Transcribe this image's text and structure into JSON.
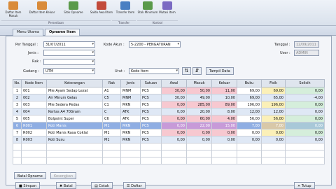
{
  "ribbon": {
    "buttons": [
      {
        "label": "Daftar Item Masuk",
        "color": "#d98b3a",
        "icon": "list-in-icon"
      },
      {
        "label": "Daftar Item Keluar",
        "color": "#d98b3a",
        "icon": "list-out-icon"
      },
      {
        "label": "Stok Opname",
        "color": "#5a9a4a",
        "icon": "stock-opname-icon"
      },
      {
        "label": "Saldo Awal Item",
        "color": "#c24a3a",
        "icon": "initial-balance-icon"
      },
      {
        "label": "Transfer Item",
        "color": "#4a7fc2",
        "icon": "transfer-icon"
      },
      {
        "label": "Stok Minimum",
        "color": "#5a9a4a",
        "icon": "min-stock-icon"
      },
      {
        "label": "Mutasi Item",
        "color": "#7a6ac2",
        "icon": "mutation-icon"
      }
    ],
    "groups": [
      "Persediaan",
      "Transfer",
      "Kontrol"
    ]
  },
  "tabs": [
    "Menu Utama",
    "Opname Item"
  ],
  "form": {
    "tanggal_label": "Per Tanggal :",
    "tanggal_value": "31/07/2011",
    "jenis_label": "Jenis :",
    "rak_label": "Rak :",
    "gudang_label": "Gudang :",
    "gudang_value": "UTM",
    "akun_label": "Kode Akun :",
    "akun_value": "5-2200 - PENGATURAN",
    "urut_label": "Urut :",
    "urut_value": "Kode Item",
    "tampil_label": "Tampil Data",
    "tanggal2_label": "Tanggal :",
    "tanggal2_value": "12/09/2011",
    "user_label": "User :",
    "user_value": "ADMIN"
  },
  "grid": {
    "headers": [
      "No.",
      "Kode Item",
      "Keterangan",
      "Rak",
      "Jenis",
      "Satuan",
      "Awal",
      "Masuk",
      "Keluar",
      "Buku",
      "Fisik",
      "Selisih"
    ],
    "rows": [
      {
        "no": "1",
        "kode": "001",
        "ket": "Mie Ayam Sedap Lezat",
        "rak": "A1",
        "jenis": "MNM",
        "satuan": "PCS",
        "awal": "30,00",
        "masuk": "50,00",
        "keluar": "11,00",
        "buku": "69,00",
        "fisik": "69,00",
        "selisih": "0,00"
      },
      {
        "no": "2",
        "kode": "002",
        "ket": "Air Minum Gelas",
        "rak": "C5",
        "jenis": "MNM",
        "satuan": "PCS",
        "awal": "30,00",
        "masuk": "49,00",
        "keluar": "10,00",
        "buku": "69,00",
        "fisik": "65,00",
        "selisih": "-4,00"
      },
      {
        "no": "3",
        "kode": "003",
        "ket": "Mie Sedera Pedas",
        "rak": "C1",
        "jenis": "MKN",
        "satuan": "PCS",
        "awal": "0,00",
        "masuk": "285,00",
        "keluar": "89,00",
        "buku": "196,00",
        "fisik": "196,00",
        "selisih": "0,00"
      },
      {
        "no": "4",
        "kode": "004",
        "ket": "Kertas A4 70Gram",
        "rak": "C",
        "jenis": "ATK",
        "satuan": "PCS",
        "awal": "0,00",
        "masuk": "20,00",
        "keluar": "8,00",
        "buku": "12,00",
        "fisik": "12,00",
        "selisih": "0,00"
      },
      {
        "no": "5",
        "kode": "005",
        "ket": "Bolpoint Super",
        "rak": "C6",
        "jenis": "ATK",
        "satuan": "PCS",
        "awal": "0,00",
        "masuk": "60,00",
        "keluar": "4,00",
        "buku": "56,00",
        "fisik": "56,00",
        "selisih": "0,00"
      },
      {
        "no": "6",
        "kode": "R001",
        "ket": "Roti Manis",
        "rak": "M1",
        "jenis": "MKN",
        "satuan": "PCS",
        "awal": "0,00",
        "masuk": "22,00",
        "keluar": "15,00",
        "buku": "7,00",
        "fisik": "7,00",
        "selisih": "0,00"
      },
      {
        "no": "7",
        "kode": "R002",
        "ket": "Roti Manis Rasa Coklat",
        "rak": "M1",
        "jenis": "MKN",
        "satuan": "PCS",
        "awal": "0,00",
        "masuk": "0,00",
        "keluar": "0,00",
        "buku": "0,00",
        "fisik": "0,00",
        "selisih": "0,00"
      },
      {
        "no": "8",
        "kode": "R003",
        "ket": "Roti Susu",
        "rak": "M1",
        "jenis": "MKN",
        "satuan": "PCS",
        "awal": "0,00",
        "masuk": "0,00",
        "keluar": "0,00",
        "buku": "0,00",
        "fisik": "0,00",
        "selisih": "0,00"
      }
    ]
  },
  "buttons": {
    "batal_opname": "Batal Opname",
    "koreksi": "Kosongkan",
    "simpan": "Simpan",
    "batal": "Batal",
    "cetak": "Cetak",
    "daftar": "Daftar",
    "tutup": "Tutup"
  }
}
